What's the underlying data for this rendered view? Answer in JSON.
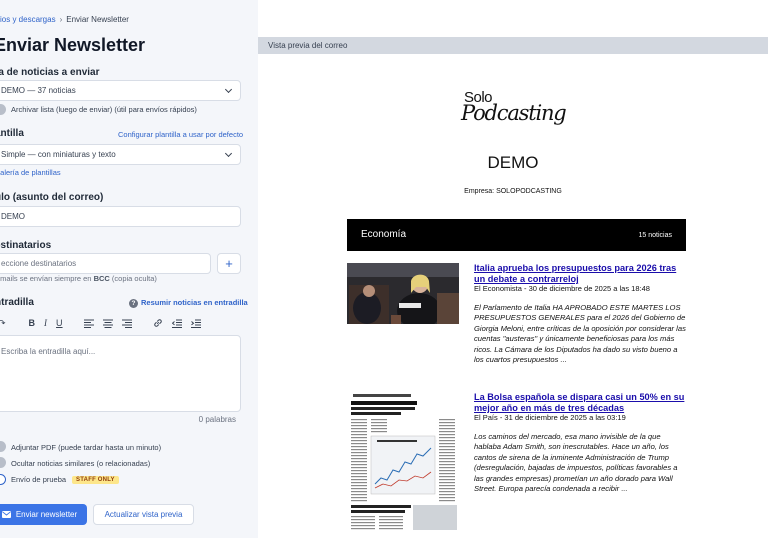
{
  "breadcrumb": {
    "parent": "ios y descargas",
    "current": "Enviar Newsletter"
  },
  "page_title": "Enviar Newsletter",
  "news_list": {
    "label": "ta de noticias a enviar",
    "selected": "DEMO — 37 noticias",
    "archive_toggle": "Archivar lista (luego de enviar) (útil para envíos rápidos)"
  },
  "template": {
    "label": "antilla",
    "configure_link": "Configurar plantilla a usar por defecto",
    "selected": "Simple — con miniaturas y texto",
    "gallery_link": "galería de plantillas"
  },
  "subject": {
    "label": "ulo (asunto del correo)",
    "value": "DEMO"
  },
  "recipients": {
    "label": "estinatarios",
    "placeholder": "eccione destinatarios",
    "add_label": "+",
    "hint_prefix": "emails se envían siempre en ",
    "hint_bold": "BCC",
    "hint_suffix": " (copia oculta)"
  },
  "intro": {
    "label": "ntradilla",
    "summarize_link": "Resumir noticias en entradilla",
    "toolbar": {
      "undo": "↶",
      "redo": "↷",
      "bold": "B",
      "italic": "I",
      "underline": "U"
    },
    "placeholder": "Escriba la entradilla aquí...",
    "word_count": "0 palabras"
  },
  "options": {
    "attach_pdf": "Adjuntar PDF (puede tardar hasta un minuto)",
    "hide_similar": "Ocultar noticias similares (o relacionadas)",
    "test_send": "Envío de prueba",
    "staff_badge": "STAFF ONLY"
  },
  "buttons": {
    "send": "Enviar newsletter",
    "refresh": "Actualizar vista previa"
  },
  "preview": {
    "bar_title": "Vista previa del correo",
    "logo_top": "Solo",
    "logo_bottom": "Podcasting",
    "list_title": "DEMO",
    "company": "Empresa: SOLOPODCASTING",
    "section_name": "Economía",
    "section_count": "15 noticias",
    "articles": [
      {
        "title": "Italia aprueba los presupuestos para 2026 tras un debate a contrarreloj",
        "meta": "El Economista - 30 de diciembre de 2025 a las 18:48",
        "body": "El Parlamento de Italia HA APROBADO ESTE MARTES LOS PRESUPUESTOS GENERALES para el 2026 del Gobierno de Giorgia Meloni, entre críticas de la oposición por considerar las cuentas \"austeras\" y únicamente beneficiosas para los más ricos. La Cámara de los Diputados ha dado su visto bueno a los cuartos presupuestos ..."
      },
      {
        "title": "La Bolsa española se dispara casi un 50% en su mejor año en más de tres décadas",
        "meta": "El País - 31 de diciembre de 2025 a las 03:19",
        "body": "Los caminos del mercado, esa mano invisible de la que hablaba Adam Smith, son inescrutables. Hace un año, los cantos de sirena de la inminente Administración de Trump (desregulación, bajadas de impuestos, políticas favorables a las grandes empresas) prometían un año dorado para Wall Street. Europa parecía condenada a recibir ..."
      }
    ]
  },
  "colors": {
    "accent": "#3b74e6",
    "link": "#2f63c9",
    "panel_bg": "#f4f6fa",
    "preview_bar": "#d3d8e0",
    "section_bar": "#000000"
  }
}
